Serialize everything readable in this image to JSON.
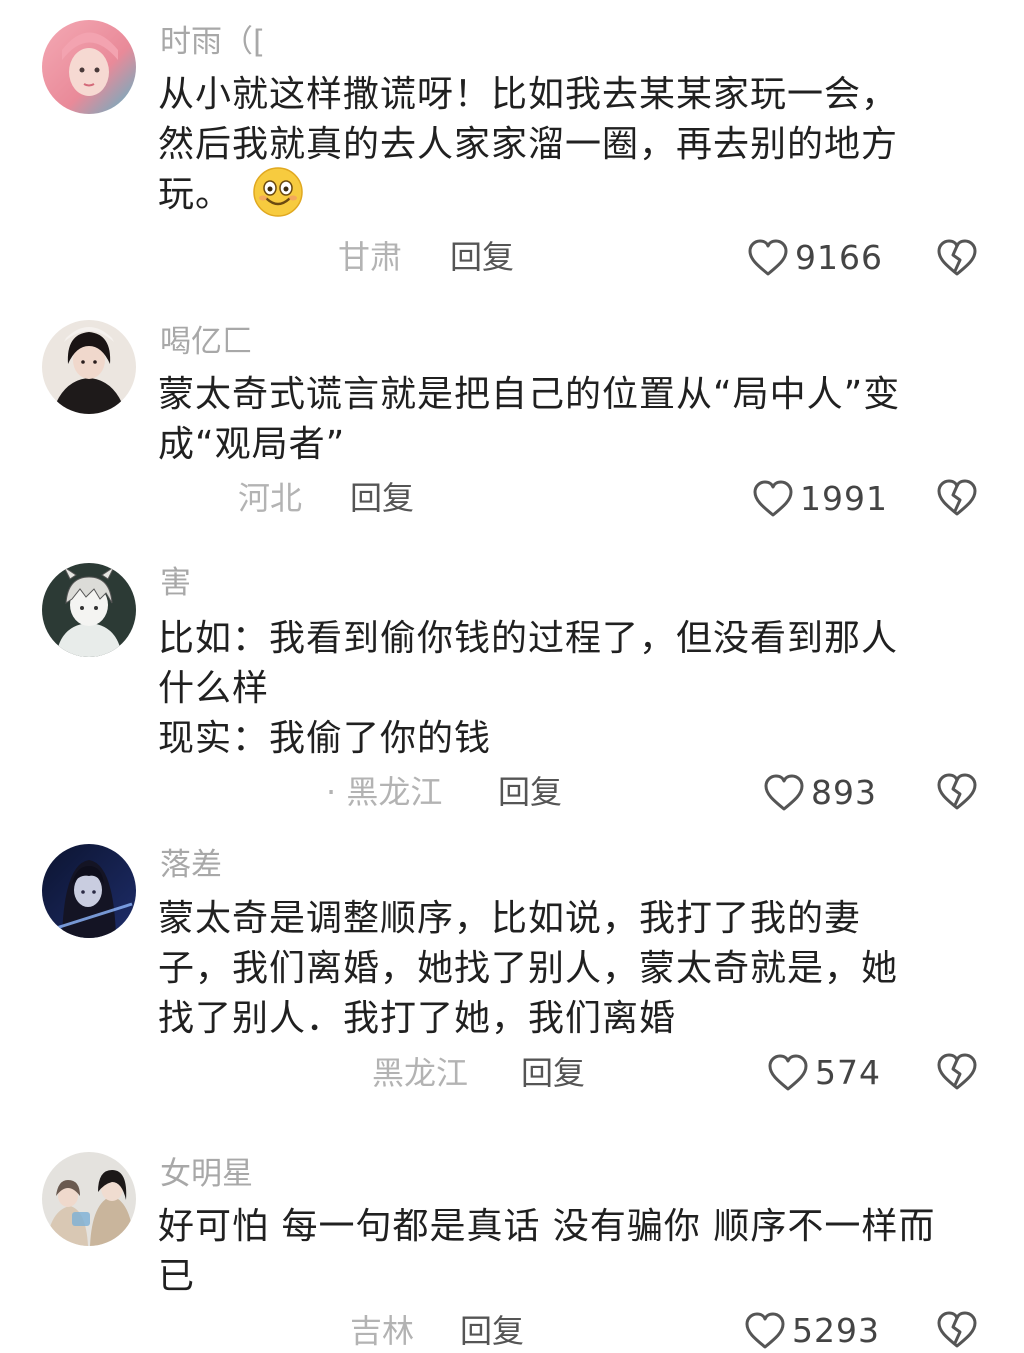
{
  "comments": [
    {
      "username": "时雨（[",
      "lines": [
        "从小就这样撒谎呀！比如我去某某家玩一会，",
        "然后我就真的去人家家溜一圈，再去别的地方",
        "玩。"
      ],
      "emoji": "smiling-face-emoji",
      "location": "甘肃",
      "reply": "回复",
      "likes": "9166"
    },
    {
      "username": "喝亿匚",
      "lines": [
        "蒙太奇式谎言就是把自己的位置从“局中人”变",
        "成“观局者”"
      ],
      "location": "河北",
      "reply": "回复",
      "likes": "1991"
    },
    {
      "username": "害",
      "lines": [
        "比如：我看到偷你钱的过程了，但没看到那人",
        "什么样",
        "现实：我偷了你的钱"
      ],
      "location": "· 黑龙江",
      "reply": "回复",
      "likes": "893"
    },
    {
      "username": "落差",
      "lines": [
        "蒙太奇是调整顺序，比如说，我打了我的妻",
        "子，我们离婚，她找了别人，蒙太奇就是，她",
        "找了别人．我打了她，我们离婚"
      ],
      "location": "黑龙江",
      "reply": "回复",
      "likes": "574"
    },
    {
      "username": "女明星",
      "lines": [
        "好可怕 每一句都是真话 没有骗你 顺序不一样而",
        "已"
      ],
      "location": "吉林",
      "reply": "回复",
      "likes": "5293"
    }
  ],
  "icons": {
    "like": "heart-outline-icon",
    "dislike": "broken-heart-icon"
  },
  "colors": {
    "text": "#202020",
    "username": "#a8a8a8",
    "location": "#b3b3b3",
    "reply": "#555555",
    "icon": "#555555"
  }
}
